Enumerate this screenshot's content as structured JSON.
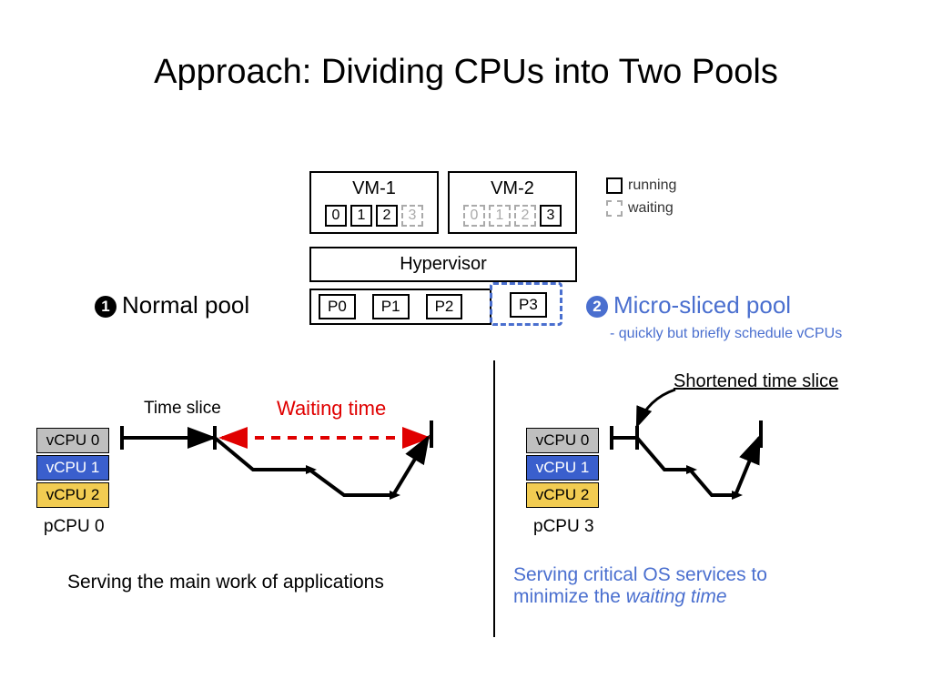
{
  "title": "Approach: Dividing CPUs into Two Pools",
  "legend": {
    "running": "running",
    "waiting": "waiting"
  },
  "vm1": {
    "label": "VM-1",
    "cpus": [
      "0",
      "1",
      "2",
      "3"
    ],
    "states": [
      "running",
      "running",
      "running",
      "waiting"
    ]
  },
  "vm2": {
    "label": "VM-2",
    "cpus": [
      "0",
      "1",
      "2",
      "3"
    ],
    "states": [
      "waiting",
      "waiting",
      "waiting",
      "running"
    ]
  },
  "hypervisor": "Hypervisor",
  "pcpus": [
    "P0",
    "P1",
    "P2",
    "P3"
  ],
  "normal_pool": {
    "num": "1",
    "label": "Normal pool"
  },
  "micro_pool": {
    "num": "2",
    "label": "Micro-sliced pool",
    "sub": "- quickly but briefly schedule vCPUs"
  },
  "left": {
    "vcpus": [
      "vCPU 0",
      "vCPU 1",
      "vCPU 2"
    ],
    "pcpu": "pCPU 0",
    "time_slice": "Time slice",
    "waiting_time": "Waiting time",
    "caption": "Serving the main work of applications"
  },
  "right": {
    "vcpus": [
      "vCPU 0",
      "vCPU 1",
      "vCPU 2"
    ],
    "pcpu": "pCPU 3",
    "short_slice": "Shortened time slice",
    "caption_a": "Serving critical OS services to",
    "caption_b": "minimize the ",
    "caption_c": "waiting time"
  }
}
